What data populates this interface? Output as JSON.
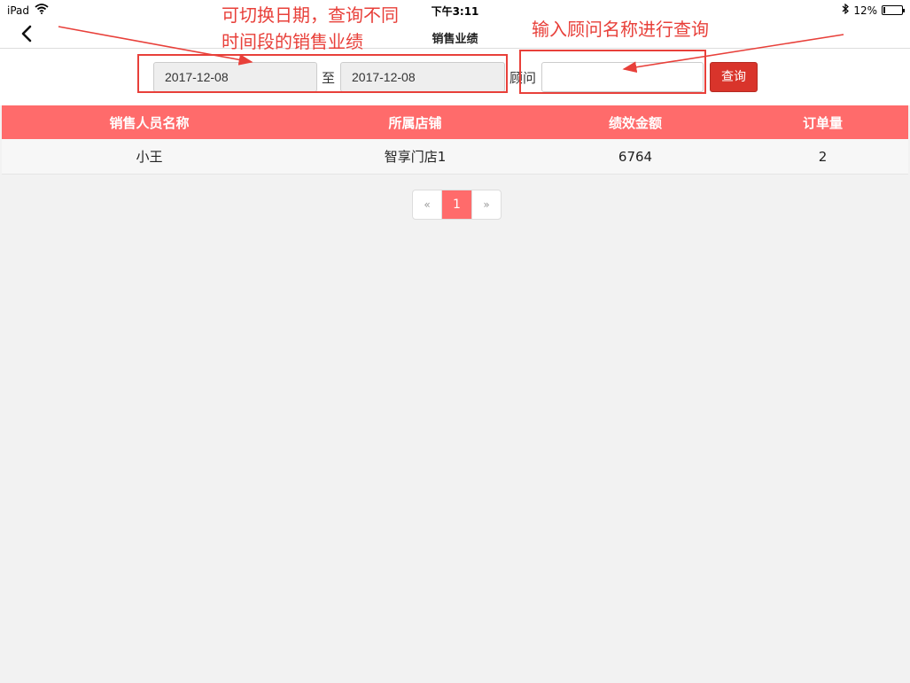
{
  "status_bar": {
    "device": "iPad",
    "time": "下午3:11",
    "battery": "12%",
    "battery_level": 0.12
  },
  "nav": {
    "title": "销售业绩",
    "back_icon": "chevron-left-icon"
  },
  "filter": {
    "start_date": "2017-12-08",
    "separator": "至",
    "end_date": "2017-12-08",
    "consultant_label": "顾问",
    "consultant_value": "",
    "query_label": "查询"
  },
  "table": {
    "columns": [
      "销售人员名称",
      "所属店铺",
      "绩效金额",
      "订单量"
    ],
    "rows": [
      [
        "小王",
        "智享门店1",
        "6764",
        "2"
      ]
    ]
  },
  "pagination": {
    "prev": "«",
    "current": "1",
    "next": "»"
  },
  "annotations": {
    "date_note_line1": "可切换日期，查询不同",
    "date_note_line2": "时间段的销售业绩",
    "consultant_note": "输入顾问名称进行查询",
    "color": "#e8403a"
  },
  "colors": {
    "header": "#ff6b6b",
    "query_button": "#d9342b"
  }
}
